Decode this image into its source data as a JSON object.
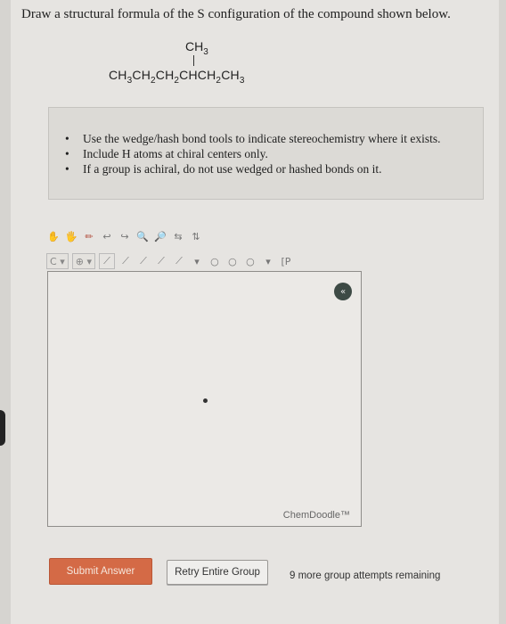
{
  "question": {
    "text": "Draw a structural formula of the S configuration of the compound shown below."
  },
  "formula": {
    "substituent": "CH3",
    "chain": "CH3CH2CH2CHCH2CH3"
  },
  "instructions": {
    "items": [
      "Use the wedge/hash bond tools to indicate stereochemistry where it exists.",
      "Include H atoms at chiral centers only.",
      "If a group is achiral, do not use wedged or hashed bonds on it."
    ],
    "bullet": "•"
  },
  "toolbar": {
    "row1": [
      "✋",
      "🖐",
      "✏",
      "↩",
      "↪",
      "🔍",
      "🔎",
      "⇆",
      "⇅"
    ],
    "row2": [
      "C",
      "▾",
      "⊕",
      "▾",
      "⟋",
      "⟋",
      "⟋",
      "⟋",
      "⟋",
      "▾",
      "○",
      "○",
      "○",
      "▾",
      "[P"
    ]
  },
  "canvas": {
    "badge": "«",
    "watermark": "ChemDoodle™"
  },
  "buttons": {
    "submit_label": "Submit Answer",
    "retry_label": "Retry Entire Group"
  },
  "status": {
    "attempts": "9 more group attempts remaining"
  }
}
